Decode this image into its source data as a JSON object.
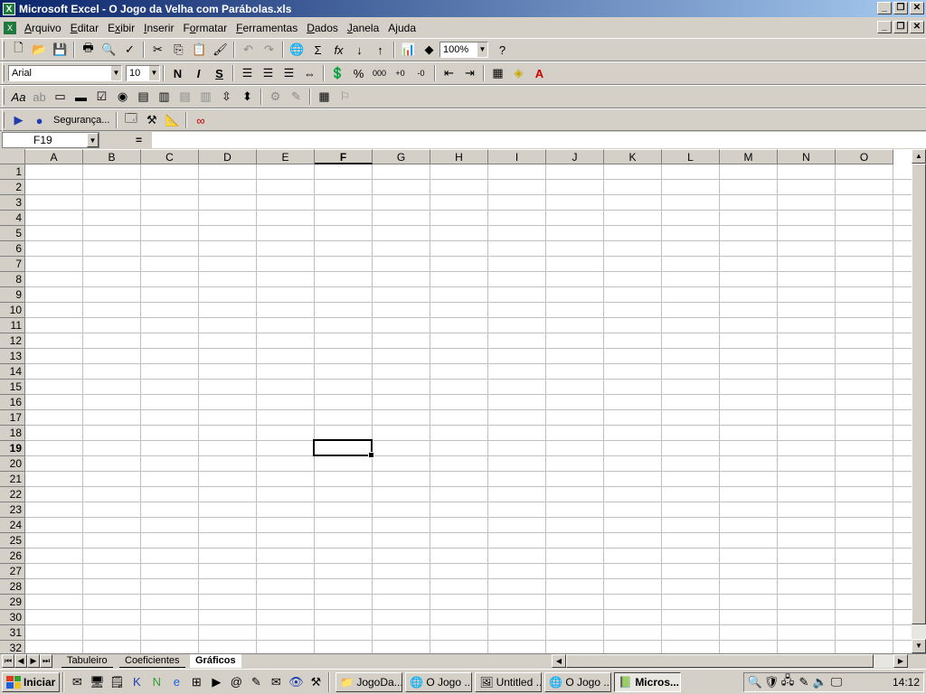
{
  "window": {
    "title": "Microsoft Excel - O Jogo da Velha com Parábolas.xls"
  },
  "menu": [
    "Arquivo",
    "Editar",
    "Exibir",
    "Inserir",
    "Formatar",
    "Ferramentas",
    "Dados",
    "Janela",
    "Ajuda"
  ],
  "menu_underline": [
    "A",
    "E",
    "x",
    "I",
    "o",
    "F",
    "D",
    "J",
    "j"
  ],
  "toolbar": {
    "zoom": "100%",
    "font": "Arial",
    "size": "10",
    "bold": "N",
    "italic": "I",
    "underline": "S",
    "percent": "%",
    "thousands": "000",
    "security": "Segurança..."
  },
  "formula_bar": {
    "name_box": "F19",
    "equals": "=",
    "value": ""
  },
  "columns": [
    "A",
    "B",
    "C",
    "D",
    "E",
    "F",
    "G",
    "H",
    "I",
    "J",
    "K",
    "L",
    "M",
    "N",
    "O"
  ],
  "rows": [
    "1",
    "2",
    "3",
    "4",
    "5",
    "6",
    "7",
    "8",
    "9",
    "10",
    "11",
    "12",
    "13",
    "14",
    "15",
    "16",
    "17",
    "18",
    "19",
    "20",
    "21",
    "22",
    "23",
    "24",
    "25",
    "26",
    "27",
    "28",
    "29",
    "30",
    "31",
    "32"
  ],
  "active_col": "F",
  "active_row": "19",
  "sheets": [
    "Tabuleiro",
    "Coeficientes",
    "Gráficos"
  ],
  "active_sheet": "Gráficos",
  "taskbar": {
    "start": "Iniciar",
    "tasks": [
      "JogoDa...",
      "O Jogo ...",
      "Untitled ...",
      "O Jogo ...",
      "Micros..."
    ],
    "active_task": 4,
    "clock": "14:12"
  },
  "colors": {
    "title_start": "#0a246a",
    "title_end": "#a6caf0",
    "chrome": "#d4d0c8",
    "excel_green": "#1e7a3c"
  }
}
